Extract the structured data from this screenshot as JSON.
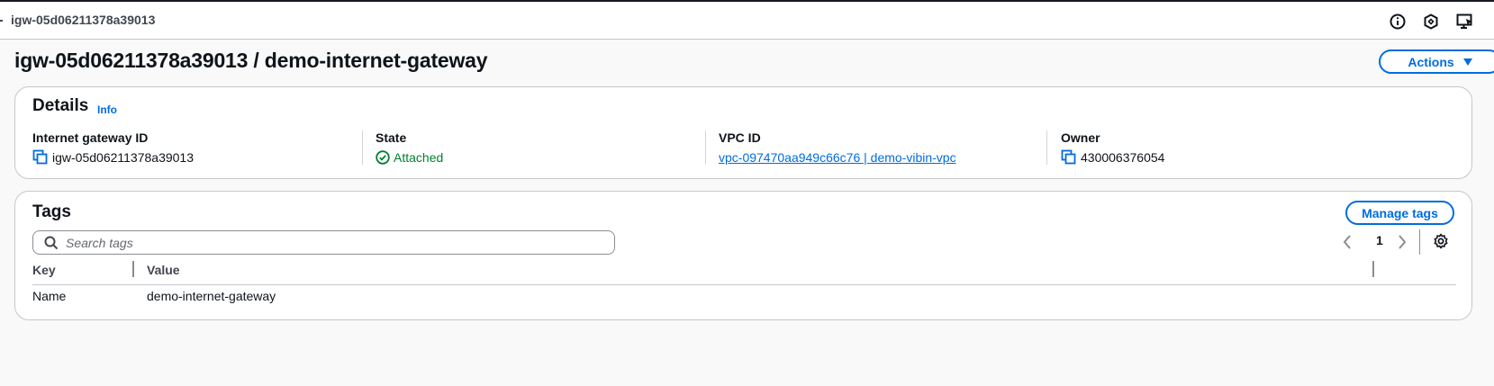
{
  "topbar": {
    "breadcrumb": "igw-05d06211378a39013",
    "icons": [
      "info-circle-icon",
      "security-shield-icon",
      "feedback-icon"
    ]
  },
  "page": {
    "title": "igw-05d06211378a39013 / demo-internet-gateway",
    "actions_label": "Actions"
  },
  "details": {
    "title": "Details",
    "info_label": "Info",
    "fields": {
      "gateway_id": {
        "label": "Internet gateway ID",
        "value": "igw-05d06211378a39013"
      },
      "state": {
        "label": "State",
        "value": "Attached"
      },
      "vpc_id": {
        "label": "VPC ID",
        "value": "vpc-097470aa949c66c76 | demo-vibin-vpc"
      },
      "owner": {
        "label": "Owner",
        "value": "430006376054"
      }
    }
  },
  "tags": {
    "title": "Tags",
    "manage_label": "Manage tags",
    "search_placeholder": "Search tags",
    "page_number": "1",
    "columns": {
      "key": "Key",
      "value": "Value"
    },
    "rows": [
      {
        "key": "Name",
        "value": "demo-internet-gateway"
      }
    ]
  },
  "colors": {
    "accent": "#006ce0",
    "success": "#00802f",
    "text": "#0f141a"
  }
}
